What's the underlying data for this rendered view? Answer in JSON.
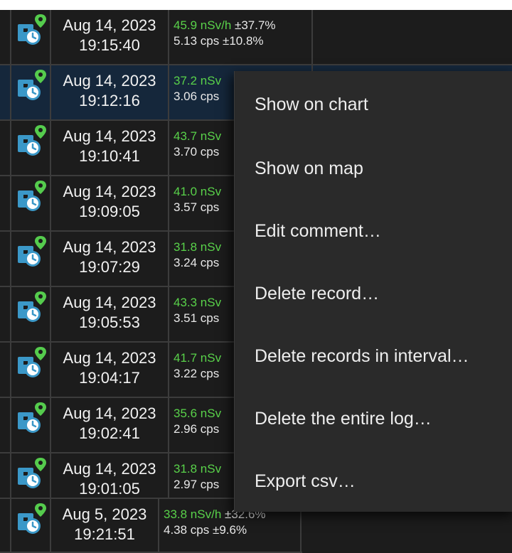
{
  "log": {
    "rows": [
      {
        "date": "Aug 14, 2023",
        "time": "19:15:40",
        "dose": "45.9 nSv/h",
        "dose_unc": " ±37.7%",
        "cps": "5.13 cps ±10.8%"
      },
      {
        "date": "Aug 14, 2023",
        "time": "19:12:16",
        "dose": "37.2 nSv",
        "dose_unc": "",
        "cps": "3.06 cps"
      },
      {
        "date": "Aug 14, 2023",
        "time": "19:10:41",
        "dose": "43.7 nSv",
        "dose_unc": "",
        "cps": "3.70 cps"
      },
      {
        "date": "Aug 14, 2023",
        "time": "19:09:05",
        "dose": "41.0 nSv",
        "dose_unc": "",
        "cps": "3.57 cps"
      },
      {
        "date": "Aug 14, 2023",
        "time": "19:07:29",
        "dose": "31.8 nSv",
        "dose_unc": "",
        "cps": "3.24 cps"
      },
      {
        "date": "Aug 14, 2023",
        "time": "19:05:53",
        "dose": "43.3 nSv",
        "dose_unc": "",
        "cps": "3.51 cps"
      },
      {
        "date": "Aug 14, 2023",
        "time": "19:04:17",
        "dose": "41.7 nSv",
        "dose_unc": "",
        "cps": "3.22 cps"
      },
      {
        "date": "Aug 14, 2023",
        "time": "19:02:41",
        "dose": "35.6 nSv",
        "dose_unc": "",
        "cps": "2.96 cps"
      },
      {
        "date": "Aug 14, 2023",
        "time": "19:01:05",
        "dose": "31.8 nSv",
        "dose_unc": "",
        "cps": "2.97 cps"
      },
      {
        "date": "Aug 5, 2023",
        "time": "19:21:51",
        "dose": "33.8 nSv/h",
        "dose_unc": " ±32.6%",
        "cps": "4.38 cps ±9.6%"
      }
    ],
    "icon": "location-record-icon",
    "colors": {
      "background": "#1c1c1c",
      "selected_row": "#15273b",
      "dose_value": "#59d24a",
      "icon_blue": "#3b98c8",
      "pin_green": "#55cc4d",
      "menu_background": "#2a2a2a"
    }
  },
  "context_menu": {
    "items": [
      {
        "label": "Show on chart"
      },
      {
        "label": "Show on map"
      },
      {
        "label": "Edit comment…"
      },
      {
        "label": "Delete record…"
      },
      {
        "label": "Delete records in interval…"
      },
      {
        "label": "Delete the entire log…"
      },
      {
        "label": "Export csv…"
      }
    ]
  }
}
